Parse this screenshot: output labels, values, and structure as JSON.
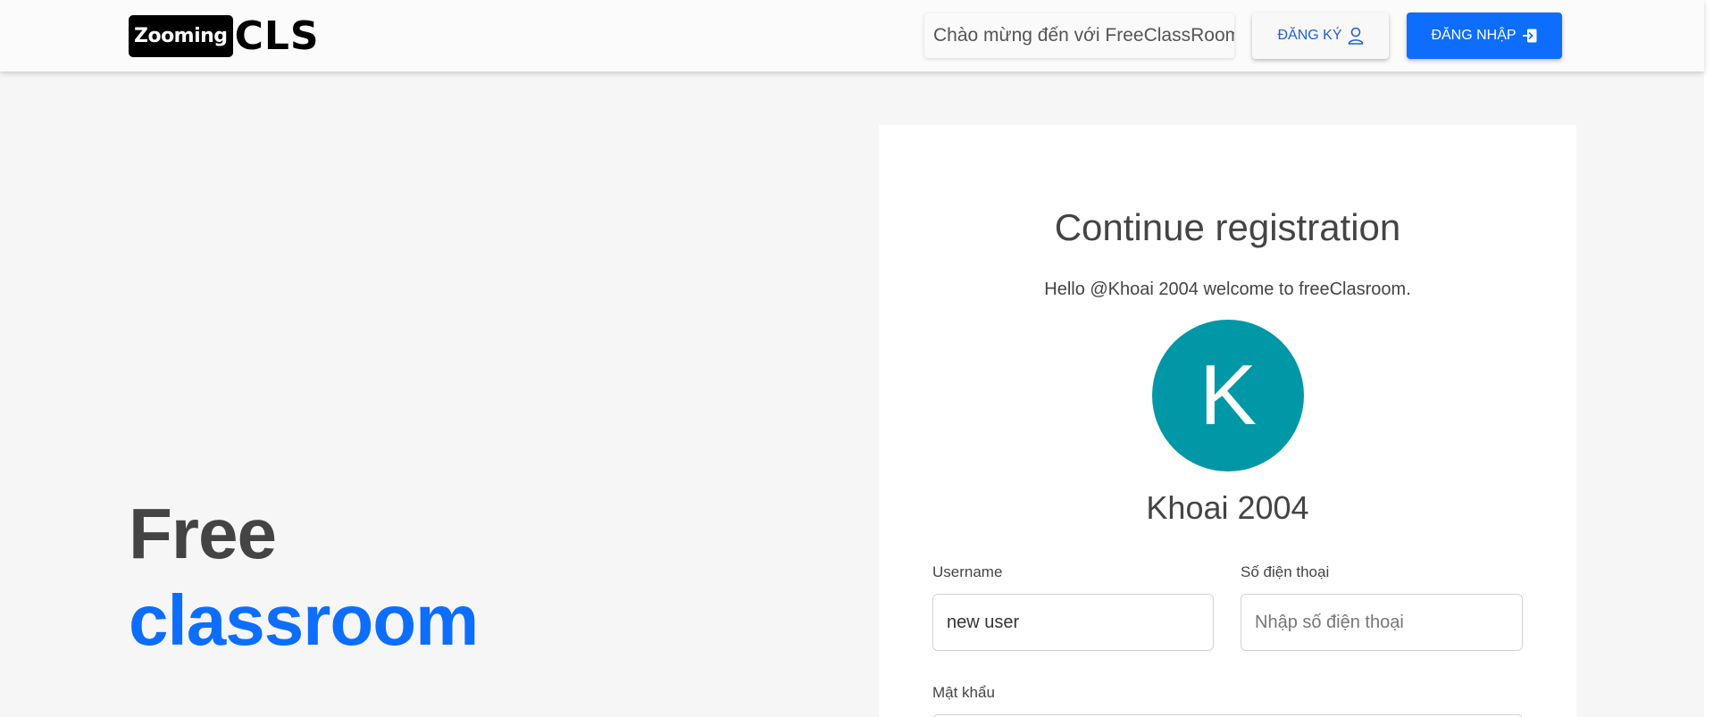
{
  "header": {
    "logo_box_text": "Zooming",
    "logo_text": "CLS",
    "welcome_text": "Chào mừng đến với FreeClassRoom",
    "register_label": "ĐĂNG KÝ",
    "login_label": "ĐĂNG NHẬP",
    "register_icon": "user-icon",
    "login_icon": "sign-in-icon"
  },
  "hero": {
    "line1": "Free",
    "line2": "classroom",
    "accent_color": "#0d6efd"
  },
  "card": {
    "title": "Continue registration",
    "greeting": "Hello @Khoai 2004 welcome to freeClasroom.",
    "avatar_initial": "K",
    "avatar_color": "#0097a7",
    "name": "Khoai 2004",
    "fields": {
      "username": {
        "label": "Username",
        "value": "new user"
      },
      "phone": {
        "label": "Số điện thoại",
        "placeholder": "Nhập số điện thoại"
      },
      "password": {
        "label": "Mật khẩu"
      }
    }
  }
}
